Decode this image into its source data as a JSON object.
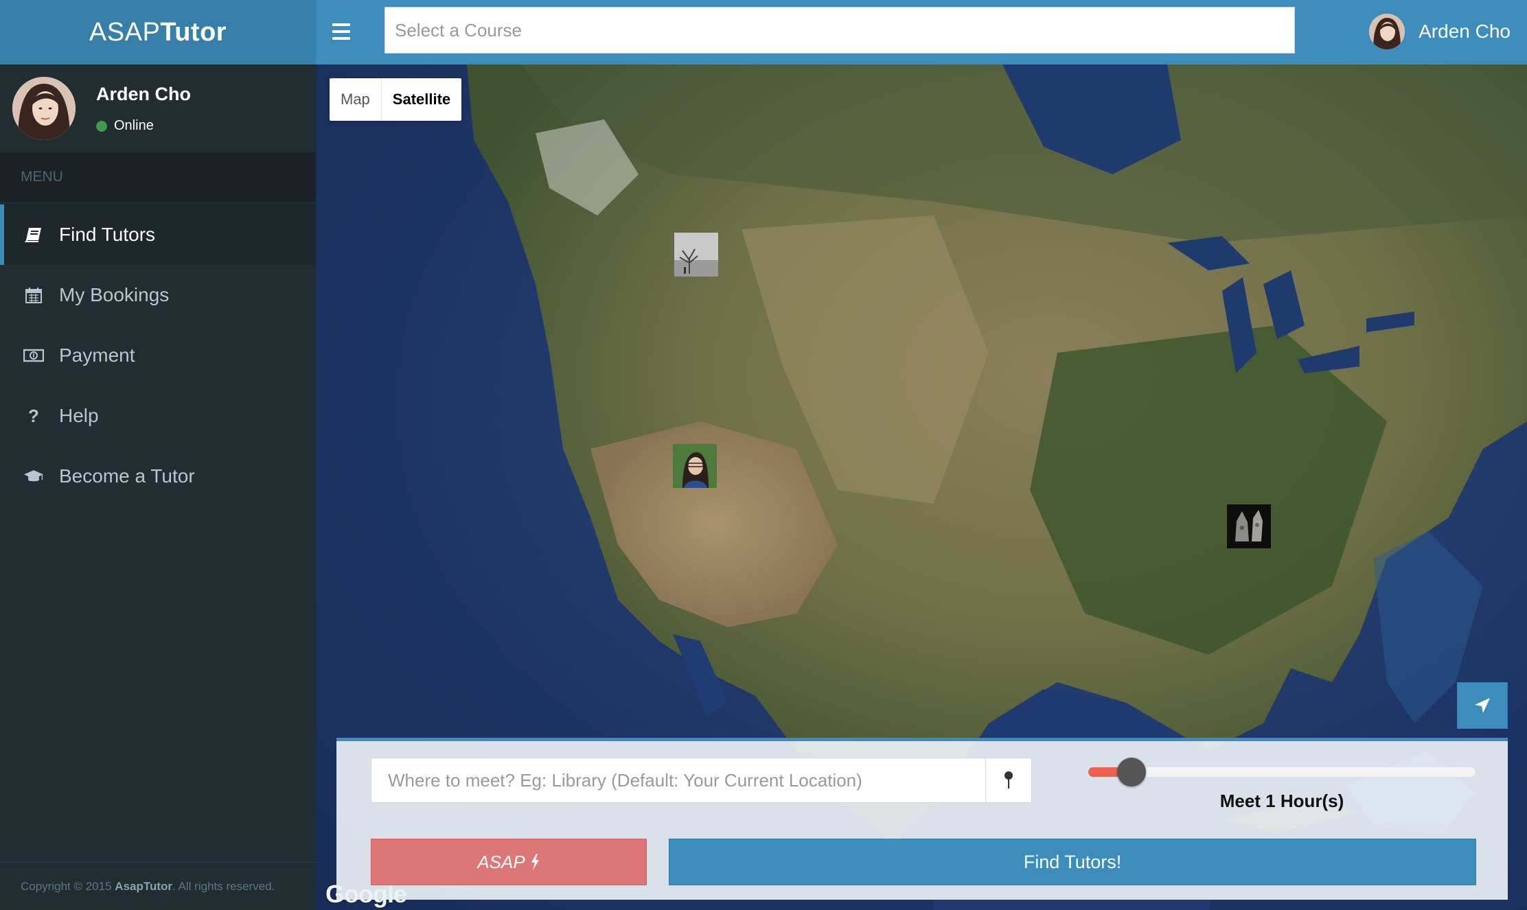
{
  "brand": {
    "light": "ASAP",
    "bold": "Tutor"
  },
  "header": {
    "course_placeholder": "Select a Course",
    "user_name": "Arden Cho"
  },
  "sidebar": {
    "user": {
      "name": "Arden Cho",
      "status": "Online"
    },
    "menu_header": "MENU",
    "items": [
      {
        "label": "Find Tutors",
        "icon": "book-icon",
        "active": true
      },
      {
        "label": "My Bookings",
        "icon": "calendar-icon",
        "active": false
      },
      {
        "label": "Payment",
        "icon": "money-icon",
        "active": false
      },
      {
        "label": "Help",
        "icon": "question-icon",
        "active": false
      },
      {
        "label": "Become a Tutor",
        "icon": "graduation-cap-icon",
        "active": false
      }
    ],
    "footer": {
      "prefix": "Copyright © 2015",
      "brand": "AsapTutor",
      "suffix": ". All rights reserved."
    }
  },
  "map": {
    "type_buttons": {
      "map": "Map",
      "satellite": "Satellite"
    },
    "selected_type": "Satellite",
    "attribution": "Google"
  },
  "search_panel": {
    "meet_placeholder": "Where to meet? Eg: Library (Default: Your Current Location)",
    "duration_label": "Meet 1 Hour(s)",
    "duration_hours": 1,
    "asap_label": "ASAP",
    "find_label": "Find Tutors!"
  },
  "colors": {
    "primary": "#3c8dbc",
    "sidebar_bg": "#222d32",
    "asap": "#dd7677",
    "slider_fill": "#f0604f",
    "online": "#3c9a49"
  }
}
